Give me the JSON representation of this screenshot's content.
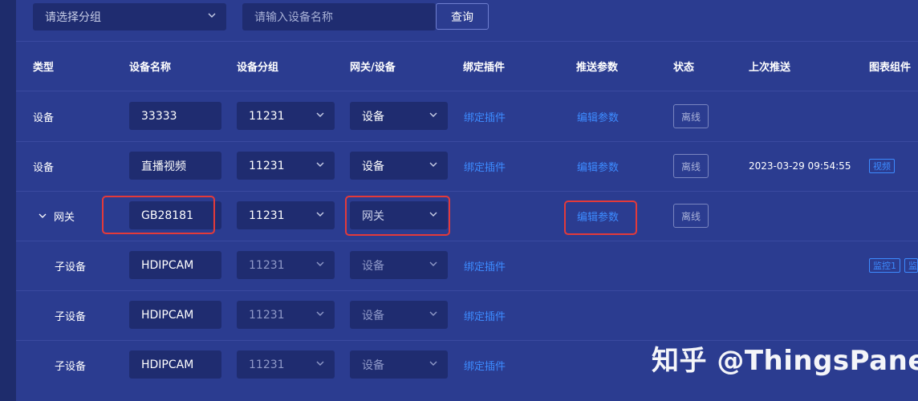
{
  "filters": {
    "group_placeholder": "请选择分组",
    "device_placeholder": "请输入设备名称",
    "query_label": "查询"
  },
  "columns": {
    "type": "类型",
    "name": "设备名称",
    "group": "设备分组",
    "gateway": "网关/设备",
    "plugin": "绑定插件",
    "params": "推送参数",
    "status": "状态",
    "last_push": "上次推送",
    "chart": "图表组件"
  },
  "rows": [
    {
      "type": "设备",
      "name": "33333",
      "group": "11231",
      "gateway": "设备",
      "plugin": "绑定插件",
      "params": "编辑参数",
      "status": "离线",
      "last_push": "",
      "charts": []
    },
    {
      "type": "设备",
      "name": "直播视频",
      "group": "11231",
      "gateway": "设备",
      "plugin": "绑定插件",
      "params": "编辑参数",
      "status": "离线",
      "last_push": "2023-03-29 09:54:55",
      "charts": [
        "视频"
      ]
    },
    {
      "type": "网关",
      "name": "GB28181",
      "group": "11231",
      "gateway": "网关",
      "plugin": "",
      "params": "编辑参数",
      "status": "离线",
      "last_push": "",
      "charts": []
    },
    {
      "type": "子设备",
      "name": "HDIPCAM",
      "group": "11231",
      "gateway": "设备",
      "plugin": "绑定插件",
      "params": "",
      "status": "",
      "last_push": "",
      "charts": [
        "监控1",
        "监"
      ]
    },
    {
      "type": "子设备",
      "name": "HDIPCAM",
      "group": "11231",
      "gateway": "设备",
      "plugin": "绑定插件",
      "params": "",
      "status": "",
      "last_push": "",
      "charts": []
    },
    {
      "type": "子设备",
      "name": "HDIPCAM",
      "group": "11231",
      "gateway": "设备",
      "plugin": "绑定插件",
      "params": "",
      "status": "",
      "last_push": "",
      "charts": []
    }
  ],
  "watermark": "知乎 @ThingsPanel",
  "colors": {
    "link": "#3d8bff",
    "highlight": "#e43a3a",
    "background": "#2b3c90",
    "field": "#1f2c70"
  }
}
